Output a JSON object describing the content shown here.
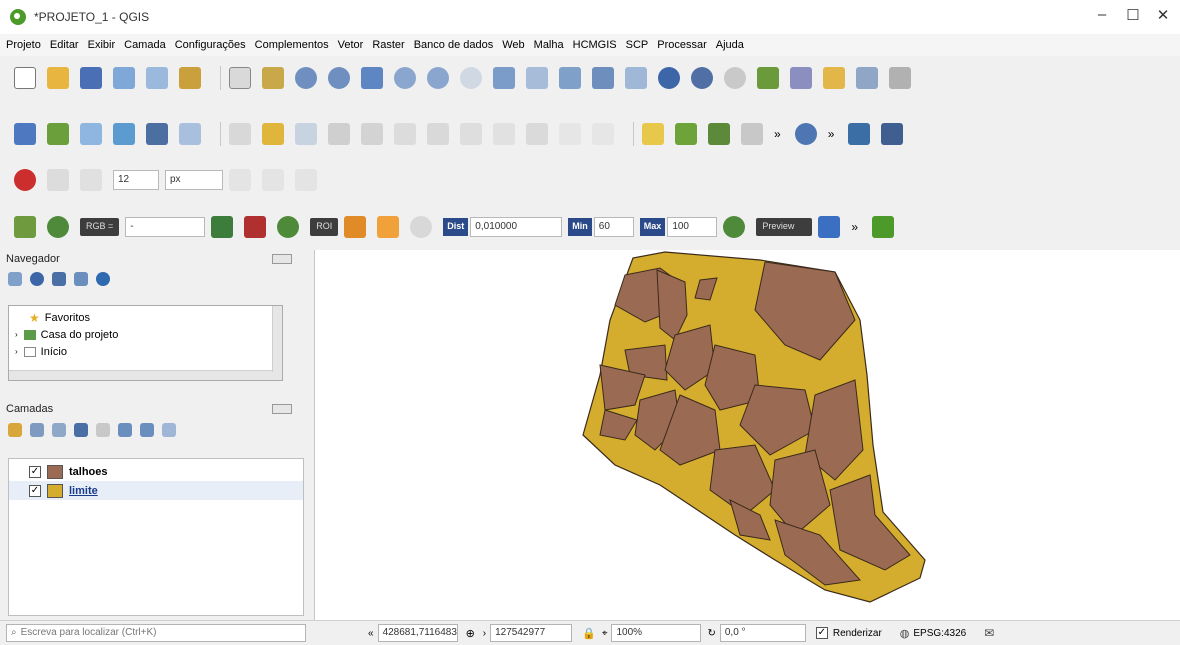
{
  "window": {
    "title": "*PROJETO_1 - QGIS",
    "minimize_glyph": "–",
    "maximize_glyph": "☐",
    "close_glyph": "✕"
  },
  "menubar": {
    "items": [
      "Projeto",
      "Editar",
      "Exibir",
      "Camada",
      "Configurações",
      "Complementos",
      "Vetor",
      "Raster",
      "Banco de dados",
      "Web",
      "Malha",
      "HCMGIS",
      "SCP",
      "Processar",
      "Ajuda"
    ]
  },
  "toolbar4": {
    "rgb_label": "RGB =",
    "rgb_value": "-",
    "roi_label": "ROI",
    "dist_label": "Dist",
    "dist_value": "0,010000",
    "min_label": "Min",
    "min_value": "60",
    "max_label": "Max",
    "max_value": "100",
    "preview_label": "Preview",
    "more_glyph": "»"
  },
  "toolbar3": {
    "size_value": "12",
    "unit_value": "px"
  },
  "navigator": {
    "title": "Navegador",
    "items": [
      {
        "label": "Favoritos",
        "icon": "star-icon"
      },
      {
        "label": "Casa do projeto",
        "icon": "project-home-icon"
      },
      {
        "label": "Início",
        "icon": "home-folder-icon"
      }
    ]
  },
  "layers": {
    "title": "Camadas",
    "items": [
      {
        "name": "talhoes",
        "checked": true,
        "color": "#9b6a52"
      },
      {
        "name": "limite",
        "checked": true,
        "color": "#d4ad2e"
      }
    ]
  },
  "statusbar": {
    "search_placeholder": "Escreva para localizar (Ctrl+K)",
    "coordinate": "428681,7116483",
    "scale": "127542977",
    "magnifier": "100%",
    "rotation": "0,0 °",
    "render_label": "Renderizar",
    "crs": "EPSG:4326"
  },
  "colors": {
    "talhoes_fill": "#9b6a52",
    "limite_fill": "#d4ad2e",
    "outline": "#3a2a1a"
  }
}
